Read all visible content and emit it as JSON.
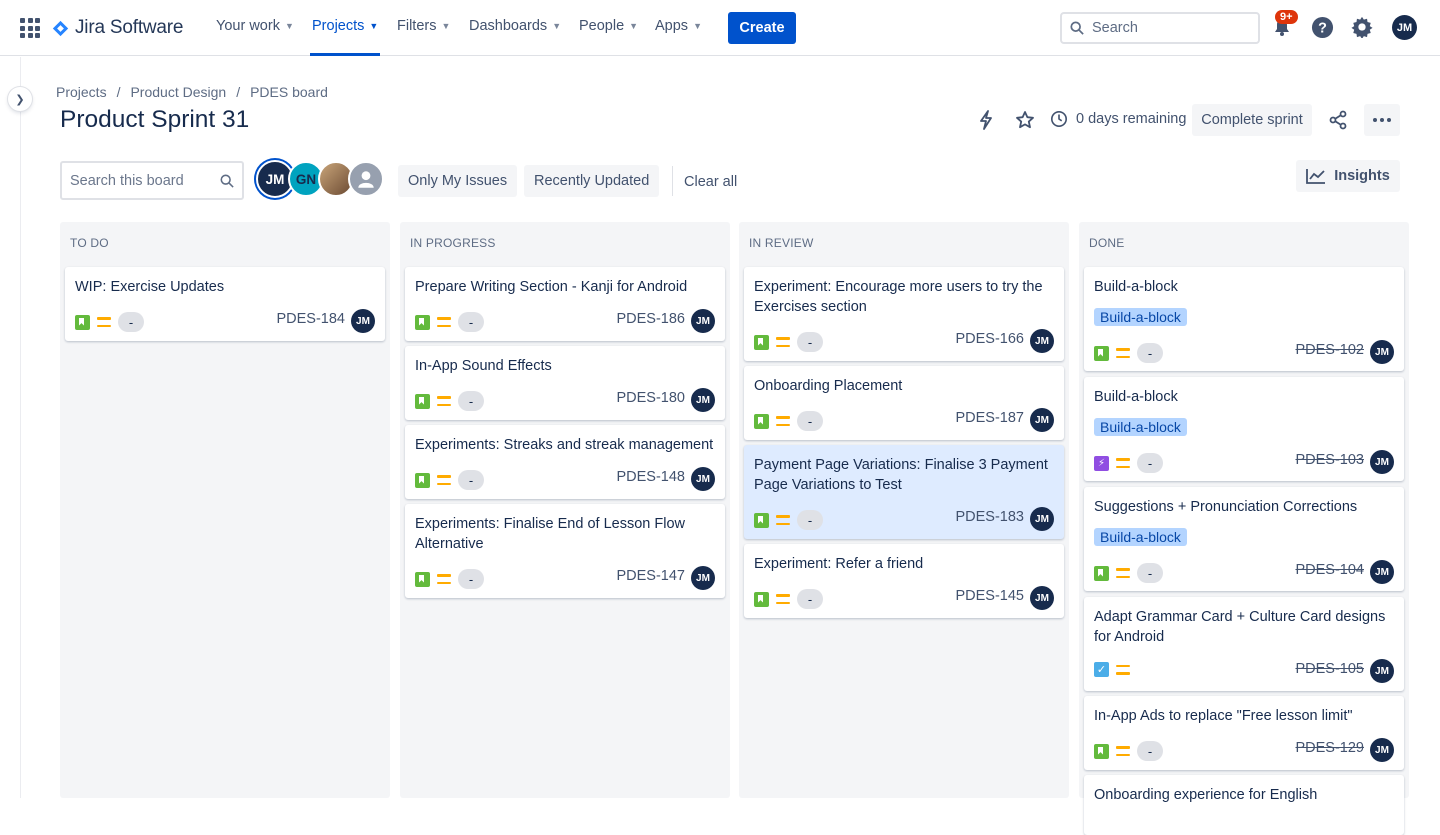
{
  "app": {
    "name": "Jira Software"
  },
  "nav": {
    "items": [
      {
        "label": "Your work"
      },
      {
        "label": "Projects"
      },
      {
        "label": "Filters"
      },
      {
        "label": "Dashboards"
      },
      {
        "label": "People"
      },
      {
        "label": "Apps"
      }
    ],
    "create_label": "Create",
    "search_placeholder": "Search",
    "notifications_badge": "9+",
    "user_initials": "JM"
  },
  "breadcrumbs": [
    "Projects",
    "Product Design",
    "PDES board"
  ],
  "breadcrumb_sep": "/",
  "page_title": "Product Sprint 31",
  "sprint": {
    "days_remaining": "0 days remaining",
    "complete_label": "Complete sprint"
  },
  "toolbar": {
    "search_placeholder": "Search this board",
    "avatars": [
      "JM",
      "GN",
      "",
      ""
    ],
    "filters": [
      "Only My Issues",
      "Recently Updated"
    ],
    "clear_all": "Clear all",
    "insights_label": "Insights"
  },
  "columns": [
    {
      "title": "TO DO",
      "cards": [
        {
          "title": "WIP: Exercise Updates",
          "key": "PDES-184",
          "type": "story",
          "assignee": "JM",
          "pill": "-"
        }
      ]
    },
    {
      "title": "IN PROGRESS",
      "cards": [
        {
          "title": "Prepare Writing Section - Kanji for Android",
          "key": "PDES-186",
          "type": "story",
          "assignee": "JM",
          "pill": "-"
        },
        {
          "title": "In-App Sound Effects",
          "key": "PDES-180",
          "type": "story",
          "assignee": "JM",
          "pill": "-"
        },
        {
          "title": "Experiments: Streaks and streak management",
          "key": "PDES-148",
          "type": "story",
          "assignee": "JM",
          "pill": "-"
        },
        {
          "title": "Experiments: Finalise End of Lesson Flow Alternative",
          "key": "PDES-147",
          "type": "story",
          "assignee": "JM",
          "pill": "-"
        }
      ]
    },
    {
      "title": "IN REVIEW",
      "cards": [
        {
          "title": "Experiment: Encourage more users to try the Exercises section",
          "key": "PDES-166",
          "type": "story",
          "assignee": "JM",
          "pill": "-"
        },
        {
          "title": "Onboarding Placement",
          "key": "PDES-187",
          "type": "story",
          "assignee": "JM",
          "pill": "-"
        },
        {
          "title": "Payment Page Variations: Finalise 3 Payment Page Variations to Test",
          "key": "PDES-183",
          "type": "story",
          "assignee": "JM",
          "pill": "-",
          "selected": true
        },
        {
          "title": "Experiment: Refer a friend",
          "key": "PDES-145",
          "type": "story",
          "assignee": "JM",
          "pill": "-"
        }
      ]
    },
    {
      "title": "DONE",
      "cards": [
        {
          "title": "Build-a-block",
          "epic": "Build-a-block",
          "key": "PDES-102",
          "type": "story",
          "assignee": "JM",
          "pill": "-",
          "done": true
        },
        {
          "title": "Build-a-block",
          "epic": "Build-a-block",
          "key": "PDES-103",
          "type": "epic",
          "assignee": "JM",
          "pill": "-",
          "done": true
        },
        {
          "title": "Suggestions + Pronunciation Corrections",
          "epic": "Build-a-block",
          "key": "PDES-104",
          "type": "story",
          "assignee": "JM",
          "pill": "-",
          "done": true
        },
        {
          "title": "Adapt Grammar Card + Culture Card designs for Android",
          "key": "PDES-105",
          "type": "task",
          "assignee": "JM",
          "done": true
        },
        {
          "title": "In-App Ads to replace \"Free lesson limit\"",
          "key": "PDES-129",
          "type": "story",
          "assignee": "JM",
          "pill": "-",
          "done": true
        },
        {
          "title": "Onboarding experience for English",
          "key": "",
          "type": "story",
          "assignee": "",
          "done": true
        }
      ]
    }
  ],
  "colors": {
    "primary": "#0052cc",
    "column_bg": "#f4f5f7",
    "selected_card": "#deebff",
    "epic_bg": "#b3d4ff",
    "story": "#63ba3c",
    "priority_medium": "#ffab00"
  }
}
